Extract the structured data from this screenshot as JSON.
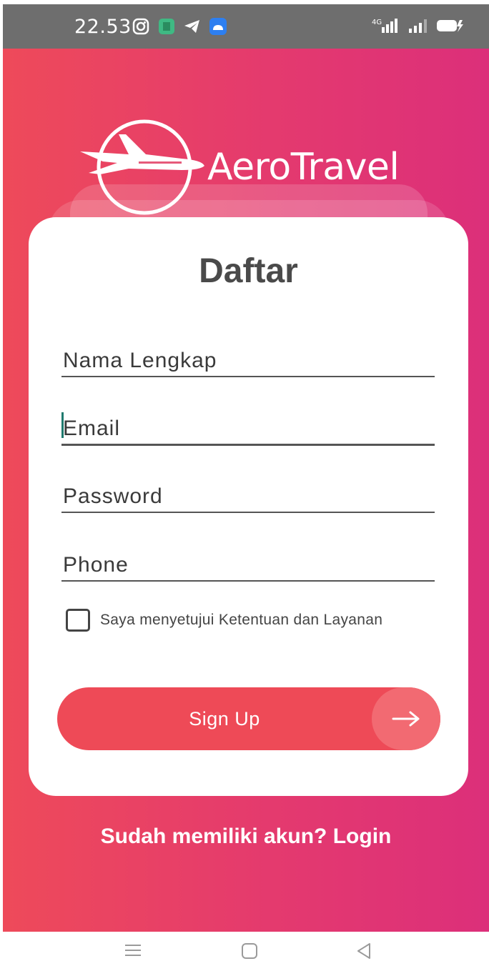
{
  "status_bar": {
    "time": "22.53",
    "icons": [
      "instagram-icon",
      "app-notification-icon",
      "telegram-icon",
      "cloud-app-icon",
      "signal-4g-icon",
      "signal-bars-icon",
      "battery-charging-icon"
    ]
  },
  "logo": {
    "text": "AeroTravel",
    "icon": "airplane-logo-icon"
  },
  "form": {
    "title": "Daftar",
    "fields": [
      {
        "placeholder": "Nama Lengkap",
        "value": ""
      },
      {
        "placeholder": "Email",
        "value": ""
      },
      {
        "placeholder": "Password",
        "value": ""
      },
      {
        "placeholder": "Phone",
        "value": ""
      }
    ],
    "terms_label": "Saya menyetujui Ketentuan dan Layanan",
    "terms_checked": false,
    "signup_label": "Sign Up",
    "signup_icon": "arrow-right-icon"
  },
  "login_link": "Sudah memiliki akun? Login",
  "nav_bar": {
    "icons": [
      "menu-icon",
      "home-icon",
      "back-icon"
    ]
  },
  "colors": {
    "gradient_start": "#ee4a5a",
    "gradient_end": "#dc2f7a",
    "button": "#ee4a57",
    "title_text": "#4a4a4a"
  }
}
